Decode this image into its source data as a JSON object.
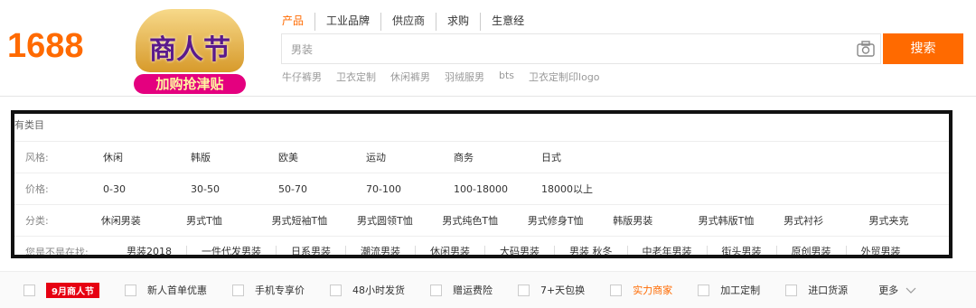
{
  "logo": "1688",
  "promo": {
    "title": "商人节",
    "ribbon": "加购抢津贴"
  },
  "tabs": [
    "产品",
    "工业品牌",
    "供应商",
    "求购",
    "生意经"
  ],
  "search": {
    "value": "男装",
    "button": "搜索"
  },
  "hotwords": [
    "牛仔裤男",
    "卫衣定制",
    "休闲裤男",
    "羽绒服男",
    "bts",
    "卫衣定制印logo"
  ],
  "filter": {
    "crumb": "有类目",
    "rows": [
      {
        "label": "风格:",
        "options": [
          "休闲",
          "韩版",
          "欧美",
          "运动",
          "商务",
          "日式"
        ]
      },
      {
        "label": "价格:",
        "options": [
          "0-30",
          "30-50",
          "50-70",
          "70-100",
          "100-18000",
          "18000以上"
        ]
      },
      {
        "label": "分类:",
        "options": [
          "休闲男装",
          "男式T恤",
          "男式短袖T恤",
          "男式圆领T恤",
          "男式纯色T恤",
          "男式修身T恤",
          "韩版男装",
          "男式韩版T恤",
          "男式衬衫",
          "男式夹克"
        ]
      }
    ],
    "suggest": {
      "label": "您是不是在找:",
      "options": [
        "男装2018",
        "一件代发男装",
        "日系男装",
        "潮流男装",
        "休闲男装",
        "大码男装",
        "男装 秋冬",
        "中老年男装",
        "街头男装",
        "原创男装",
        "外贸男装"
      ]
    }
  },
  "services": {
    "badge": "9月商人节",
    "items": [
      "新人首单优惠",
      "手机专享价",
      "48小时发货",
      "赠运费险",
      "7+天包换",
      "实力商家",
      "加工定制",
      "进口货源"
    ],
    "more": "更多"
  },
  "colors": {
    "accent": "#ff6a00",
    "badge": "#e60012"
  }
}
